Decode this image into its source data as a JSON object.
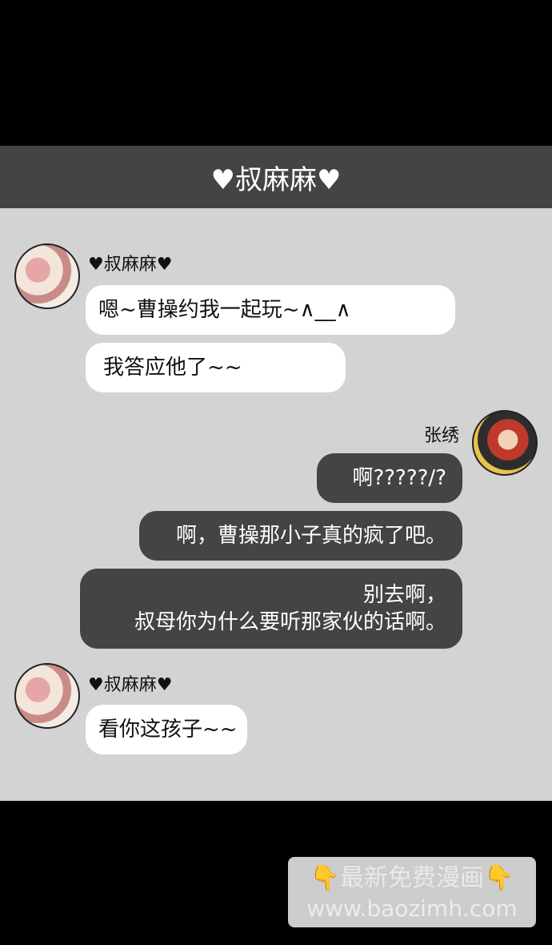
{
  "header": {
    "title": "♥叔麻麻♥"
  },
  "messages": [
    {
      "sender": "♥叔麻麻♥",
      "side": "left",
      "lines": [
        "嗯~曹操约我一起玩~∧__∧"
      ]
    },
    {
      "sender": "♥叔麻麻♥",
      "side": "left",
      "lines": [
        "我答应他了~~"
      ]
    },
    {
      "sender": "张绣",
      "side": "right",
      "lines": [
        "啊?????/?"
      ]
    },
    {
      "sender": "张绣",
      "side": "right",
      "lines": [
        "啊，曹操那小子真的疯了吧。"
      ]
    },
    {
      "sender": "张绣",
      "side": "right",
      "lines": [
        "别去啊，",
        "叔母你为什么要听那家伙的话啊。"
      ]
    },
    {
      "sender": "♥叔麻麻♥",
      "side": "left",
      "lines": [
        "看你这孩子~~"
      ]
    }
  ],
  "watermark": {
    "line1": "最新免费漫画",
    "line2": "www.baozimh.com",
    "icon": "pointing-down-icon"
  },
  "colors": {
    "header_bg": "#444444",
    "panel_bg": "#d3d3d3",
    "incoming_bubble": "#ffffff",
    "outgoing_bubble": "#444444"
  }
}
